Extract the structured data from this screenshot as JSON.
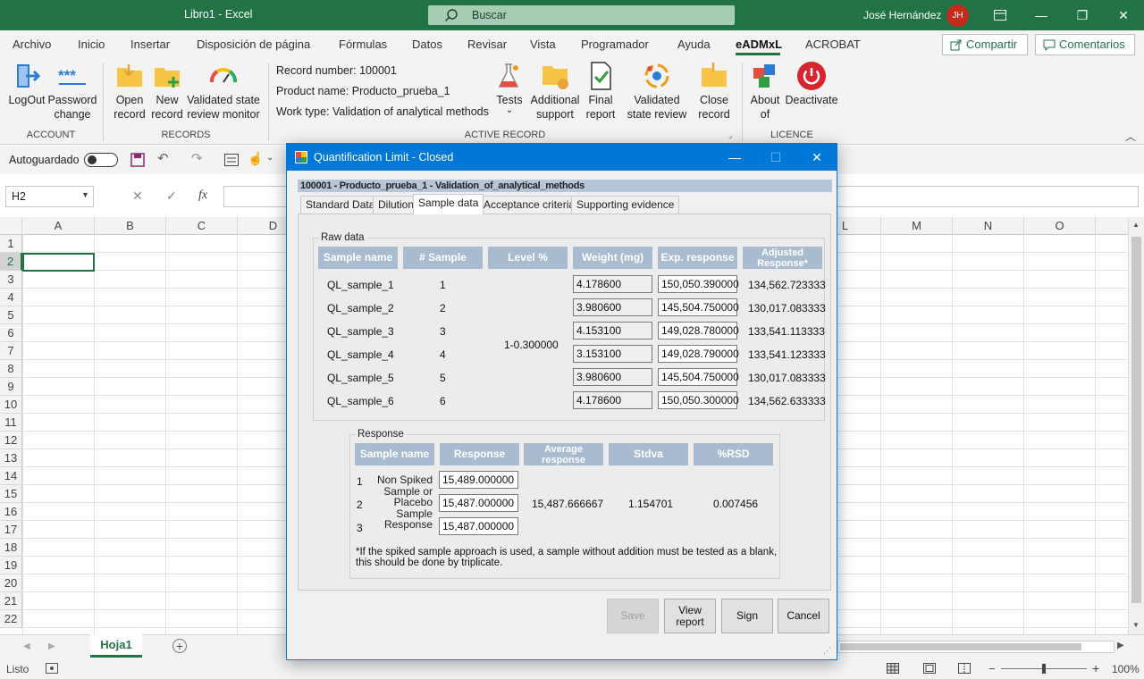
{
  "window": {
    "title": "Libro1  -  Excel",
    "search_placeholder": "Buscar",
    "user_name": "José Hernández",
    "user_initials": "JH"
  },
  "ribbon_tabs": [
    "Archivo",
    "Inicio",
    "Insertar",
    "Disposición de página",
    "Fórmulas",
    "Datos",
    "Revisar",
    "Vista",
    "Programador",
    "Ayuda",
    "eADMxL",
    "ACROBAT"
  ],
  "active_ribbon_tab": "eADMxL",
  "share_button": "Compartir",
  "comments_button": "Comentarios",
  "ribbon": {
    "account": {
      "label": "ACCOUNT",
      "logout": "LogOut",
      "password_1": "Password",
      "password_2": "change"
    },
    "records": {
      "label": "RECORDS",
      "open_1": "Open",
      "open_2": "record",
      "new_1": "New",
      "new_2": "record",
      "monitor_1": "Validated state",
      "monitor_2": "review monitor"
    },
    "active_record": {
      "label": "ACTIVE RECORD",
      "record_number": "Record number: 100001",
      "product_name": "Product name: Producto_prueba_1",
      "work_type": "Work type: Validation of analytical methods",
      "tests": "Tests",
      "tests_arrow": "⌄",
      "support_1": "Additional",
      "support_2": "support",
      "final_1": "Final",
      "final_2": "report",
      "validated_1": "Validated",
      "validated_2": "state review",
      "close_1": "Close",
      "close_2": "record"
    },
    "licence": {
      "label": "LICENCE",
      "about_1": "About",
      "about_2": "of",
      "deactivate": "Deactivate"
    }
  },
  "quickbar": {
    "autosave_label": "Autoguardado"
  },
  "formula_bar": {
    "name_box": "H2",
    "fx": "fx"
  },
  "columns": [
    "A",
    "B",
    "C",
    "D",
    "L",
    "M",
    "N",
    "O"
  ],
  "rows": [
    "1",
    "2",
    "3",
    "4",
    "5",
    "6",
    "7",
    "8",
    "9",
    "10",
    "11",
    "12",
    "13",
    "14",
    "15",
    "16",
    "17",
    "18",
    "19",
    "20",
    "21",
    "22"
  ],
  "sheet_tab": "Hoja1",
  "status": {
    "ready": "Listo",
    "zoom": "100%"
  },
  "dialog": {
    "title": "Quantification Limit  - Closed",
    "record_header": "100001 - Producto_prueba_1 - Validation_of_analytical_methods",
    "tabs": [
      "Standard Data",
      "Dilution",
      "Sample data",
      "Acceptance criteria",
      "Supporting evidence"
    ],
    "active_tab": "Sample data",
    "raw_data": {
      "legend": "Raw data",
      "headers": {
        "name": "Sample name",
        "num": "# Sample",
        "level": "Level %",
        "weight": "Weight (mg)",
        "exp": "Exp. response",
        "adj_1": "Adjusted",
        "adj_2": "Response*"
      },
      "level_value": "1-0.300000",
      "rows": [
        {
          "name": "QL_sample_1",
          "num": "1",
          "weight": "4.178600",
          "exp": "150,050.390000",
          "adj": "134,562.723333"
        },
        {
          "name": "QL_sample_2",
          "num": "2",
          "weight": "3.980600",
          "exp": "145,504.750000",
          "adj": "130,017.083333"
        },
        {
          "name": "QL_sample_3",
          "num": "3",
          "weight": "4.153100",
          "exp": "149,028.780000",
          "adj": "133,541.113333"
        },
        {
          "name": "QL_sample_4",
          "num": "4",
          "weight": "3.153100",
          "exp": "149,028.790000",
          "adj": "133,541.123333"
        },
        {
          "name": "QL_sample_5",
          "num": "5",
          "weight": "3.980600",
          "exp": "145,504.750000",
          "adj": "130,017.083333"
        },
        {
          "name": "QL_sample_6",
          "num": "6",
          "weight": "4.178600",
          "exp": "150,050.300000",
          "adj": "134,562.633333"
        }
      ]
    },
    "response": {
      "legend": "Response",
      "headers": {
        "name": "Sample name",
        "resp": "Response",
        "avg_1": "Average",
        "avg_2": "response",
        "stdva": "Stdva",
        "rsd": "%RSD"
      },
      "rows": [
        {
          "num": "1",
          "resp": "15,489.000000"
        },
        {
          "num": "2",
          "resp": "15,487.000000"
        },
        {
          "num": "3",
          "resp": "15,487.000000"
        }
      ],
      "label_lines": [
        "Non Spiked",
        "Sample or",
        "Placebo",
        "Sample",
        "Response"
      ],
      "average": "15,487.666667",
      "stdva": "1.154701",
      "rsd": "0.007456",
      "note_1": "*If the spiked sample approach is used, a sample without addition must be tested as a blank,",
      "note_2": "this should be done by triplicate."
    },
    "buttons": {
      "save": "Save",
      "view_1": "View",
      "view_2": "report",
      "sign": "Sign",
      "cancel": "Cancel"
    }
  }
}
